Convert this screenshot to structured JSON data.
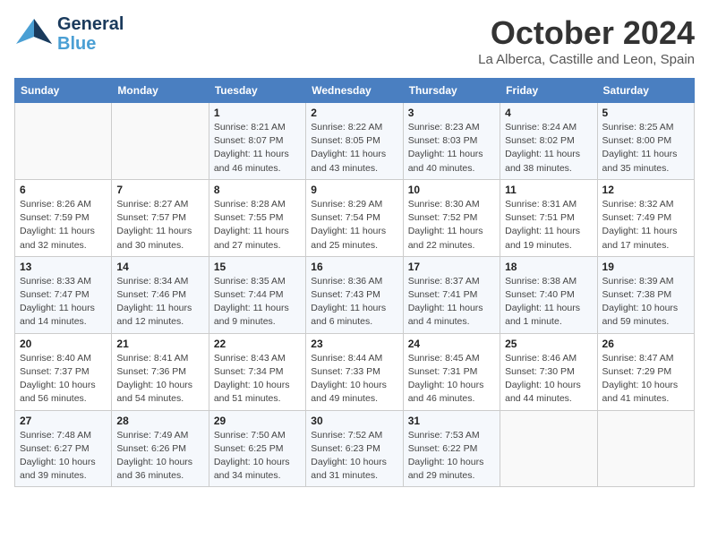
{
  "header": {
    "logo_line1": "General",
    "logo_line2": "Blue",
    "month_title": "October 2024",
    "subtitle": "La Alberca, Castille and Leon, Spain"
  },
  "weekdays": [
    "Sunday",
    "Monday",
    "Tuesday",
    "Wednesday",
    "Thursday",
    "Friday",
    "Saturday"
  ],
  "weeks": [
    [
      {
        "day": "",
        "info": ""
      },
      {
        "day": "",
        "info": ""
      },
      {
        "day": "1",
        "info": "Sunrise: 8:21 AM\nSunset: 8:07 PM\nDaylight: 11 hours and 46 minutes."
      },
      {
        "day": "2",
        "info": "Sunrise: 8:22 AM\nSunset: 8:05 PM\nDaylight: 11 hours and 43 minutes."
      },
      {
        "day": "3",
        "info": "Sunrise: 8:23 AM\nSunset: 8:03 PM\nDaylight: 11 hours and 40 minutes."
      },
      {
        "day": "4",
        "info": "Sunrise: 8:24 AM\nSunset: 8:02 PM\nDaylight: 11 hours and 38 minutes."
      },
      {
        "day": "5",
        "info": "Sunrise: 8:25 AM\nSunset: 8:00 PM\nDaylight: 11 hours and 35 minutes."
      }
    ],
    [
      {
        "day": "6",
        "info": "Sunrise: 8:26 AM\nSunset: 7:59 PM\nDaylight: 11 hours and 32 minutes."
      },
      {
        "day": "7",
        "info": "Sunrise: 8:27 AM\nSunset: 7:57 PM\nDaylight: 11 hours and 30 minutes."
      },
      {
        "day": "8",
        "info": "Sunrise: 8:28 AM\nSunset: 7:55 PM\nDaylight: 11 hours and 27 minutes."
      },
      {
        "day": "9",
        "info": "Sunrise: 8:29 AM\nSunset: 7:54 PM\nDaylight: 11 hours and 25 minutes."
      },
      {
        "day": "10",
        "info": "Sunrise: 8:30 AM\nSunset: 7:52 PM\nDaylight: 11 hours and 22 minutes."
      },
      {
        "day": "11",
        "info": "Sunrise: 8:31 AM\nSunset: 7:51 PM\nDaylight: 11 hours and 19 minutes."
      },
      {
        "day": "12",
        "info": "Sunrise: 8:32 AM\nSunset: 7:49 PM\nDaylight: 11 hours and 17 minutes."
      }
    ],
    [
      {
        "day": "13",
        "info": "Sunrise: 8:33 AM\nSunset: 7:47 PM\nDaylight: 11 hours and 14 minutes."
      },
      {
        "day": "14",
        "info": "Sunrise: 8:34 AM\nSunset: 7:46 PM\nDaylight: 11 hours and 12 minutes."
      },
      {
        "day": "15",
        "info": "Sunrise: 8:35 AM\nSunset: 7:44 PM\nDaylight: 11 hours and 9 minutes."
      },
      {
        "day": "16",
        "info": "Sunrise: 8:36 AM\nSunset: 7:43 PM\nDaylight: 11 hours and 6 minutes."
      },
      {
        "day": "17",
        "info": "Sunrise: 8:37 AM\nSunset: 7:41 PM\nDaylight: 11 hours and 4 minutes."
      },
      {
        "day": "18",
        "info": "Sunrise: 8:38 AM\nSunset: 7:40 PM\nDaylight: 11 hours and 1 minute."
      },
      {
        "day": "19",
        "info": "Sunrise: 8:39 AM\nSunset: 7:38 PM\nDaylight: 10 hours and 59 minutes."
      }
    ],
    [
      {
        "day": "20",
        "info": "Sunrise: 8:40 AM\nSunset: 7:37 PM\nDaylight: 10 hours and 56 minutes."
      },
      {
        "day": "21",
        "info": "Sunrise: 8:41 AM\nSunset: 7:36 PM\nDaylight: 10 hours and 54 minutes."
      },
      {
        "day": "22",
        "info": "Sunrise: 8:43 AM\nSunset: 7:34 PM\nDaylight: 10 hours and 51 minutes."
      },
      {
        "day": "23",
        "info": "Sunrise: 8:44 AM\nSunset: 7:33 PM\nDaylight: 10 hours and 49 minutes."
      },
      {
        "day": "24",
        "info": "Sunrise: 8:45 AM\nSunset: 7:31 PM\nDaylight: 10 hours and 46 minutes."
      },
      {
        "day": "25",
        "info": "Sunrise: 8:46 AM\nSunset: 7:30 PM\nDaylight: 10 hours and 44 minutes."
      },
      {
        "day": "26",
        "info": "Sunrise: 8:47 AM\nSunset: 7:29 PM\nDaylight: 10 hours and 41 minutes."
      }
    ],
    [
      {
        "day": "27",
        "info": "Sunrise: 7:48 AM\nSunset: 6:27 PM\nDaylight: 10 hours and 39 minutes."
      },
      {
        "day": "28",
        "info": "Sunrise: 7:49 AM\nSunset: 6:26 PM\nDaylight: 10 hours and 36 minutes."
      },
      {
        "day": "29",
        "info": "Sunrise: 7:50 AM\nSunset: 6:25 PM\nDaylight: 10 hours and 34 minutes."
      },
      {
        "day": "30",
        "info": "Sunrise: 7:52 AM\nSunset: 6:23 PM\nDaylight: 10 hours and 31 minutes."
      },
      {
        "day": "31",
        "info": "Sunrise: 7:53 AM\nSunset: 6:22 PM\nDaylight: 10 hours and 29 minutes."
      },
      {
        "day": "",
        "info": ""
      },
      {
        "day": "",
        "info": ""
      }
    ]
  ]
}
